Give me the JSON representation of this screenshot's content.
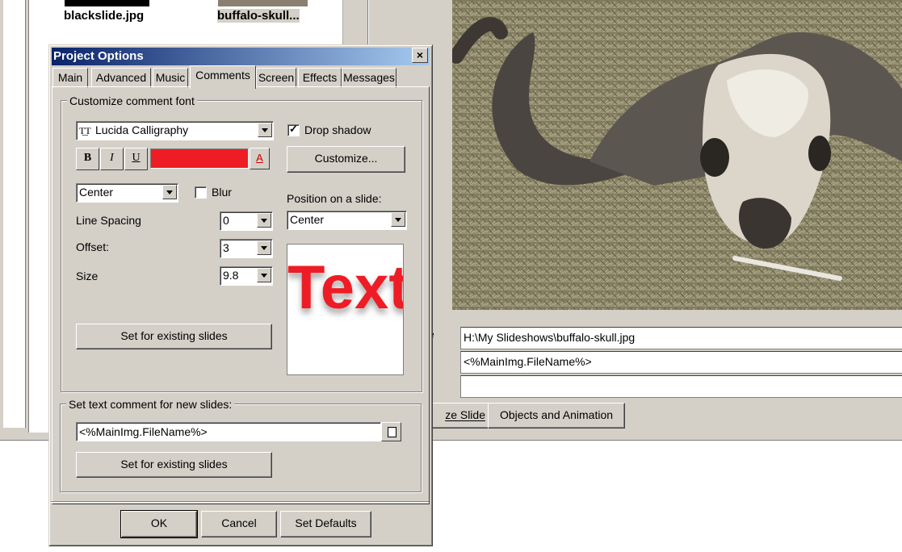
{
  "background": {
    "thumbnails": [
      {
        "label": "blackslide.jpg"
      },
      {
        "label": "buffalo-skull..."
      }
    ],
    "fields": {
      "file_label_fragment": "e",
      "file_path": "H:\\My Slideshows\\buffalo-skull.jpg",
      "comment": "<%MainImg.FileName%>",
      "empty": ""
    },
    "buttons": {
      "customize_slide": "ze Slide",
      "objects_animation": "Objects and Animation"
    }
  },
  "dialog": {
    "title": "Project Options",
    "close": "×",
    "tabs": [
      {
        "label": "Main"
      },
      {
        "label": "Advanced"
      },
      {
        "label": "Music"
      },
      {
        "label": "Comments",
        "active": true
      },
      {
        "label": "Screen"
      },
      {
        "label": "Effects"
      },
      {
        "label": "Messages"
      }
    ],
    "font_group": {
      "title": "Customize comment font",
      "font_name": "Lucida Calligraphy",
      "font_icon": "truetype-font-icon",
      "drop_shadow_label": "Drop shadow",
      "drop_shadow_checked": true,
      "bold": "B",
      "italic": "I",
      "underline": "U",
      "color": "#ee1c25",
      "color_button": "A",
      "customize_button": "Customize...",
      "align_value": "Center",
      "blur_label": "Blur",
      "blur_checked": false,
      "position_label": "Position on a slide:",
      "position_value": "Center",
      "line_spacing_label": "Line Spacing",
      "line_spacing_value": "0",
      "offset_label": "Offset:",
      "offset_value": "3",
      "size_label": "Size",
      "size_value": "9.8",
      "set_existing": "Set for existing slides",
      "preview_text": "Text"
    },
    "comment_group": {
      "title": "Set text comment for new slides:",
      "value": "<%MainImg.FileName%>",
      "set_existing": "Set for existing slides"
    },
    "footer": {
      "ok": "OK",
      "cancel": "Cancel",
      "defaults": "Set Defaults"
    }
  }
}
